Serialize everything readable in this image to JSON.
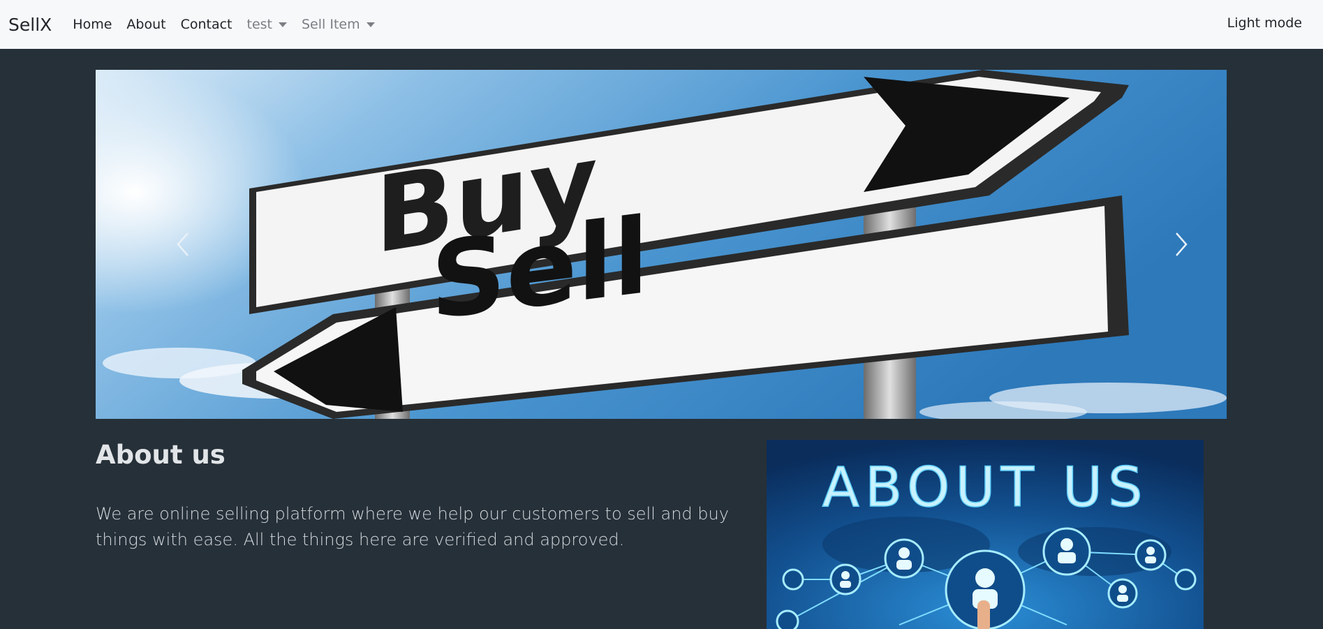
{
  "navbar": {
    "brand": "SellX",
    "links": [
      {
        "label": "Home"
      },
      {
        "label": "About"
      },
      {
        "label": "Contact"
      }
    ],
    "dropdowns": [
      {
        "label": "test"
      },
      {
        "label": "Sell Item"
      }
    ],
    "theme_toggle": "Light mode"
  },
  "carousel": {
    "slide_sign_top": "Buy",
    "slide_sign_bottom": "Sell"
  },
  "about": {
    "title": "About us",
    "text": "We are online selling platform where we help our customers to sell and buy things with ease. All the things here are verified and approved.",
    "image_heading": "ABOUT US"
  },
  "colors": {
    "page_background": "#263038",
    "navbar_background": "#f7f8fa",
    "sky_blue": "#2d7cbd"
  }
}
